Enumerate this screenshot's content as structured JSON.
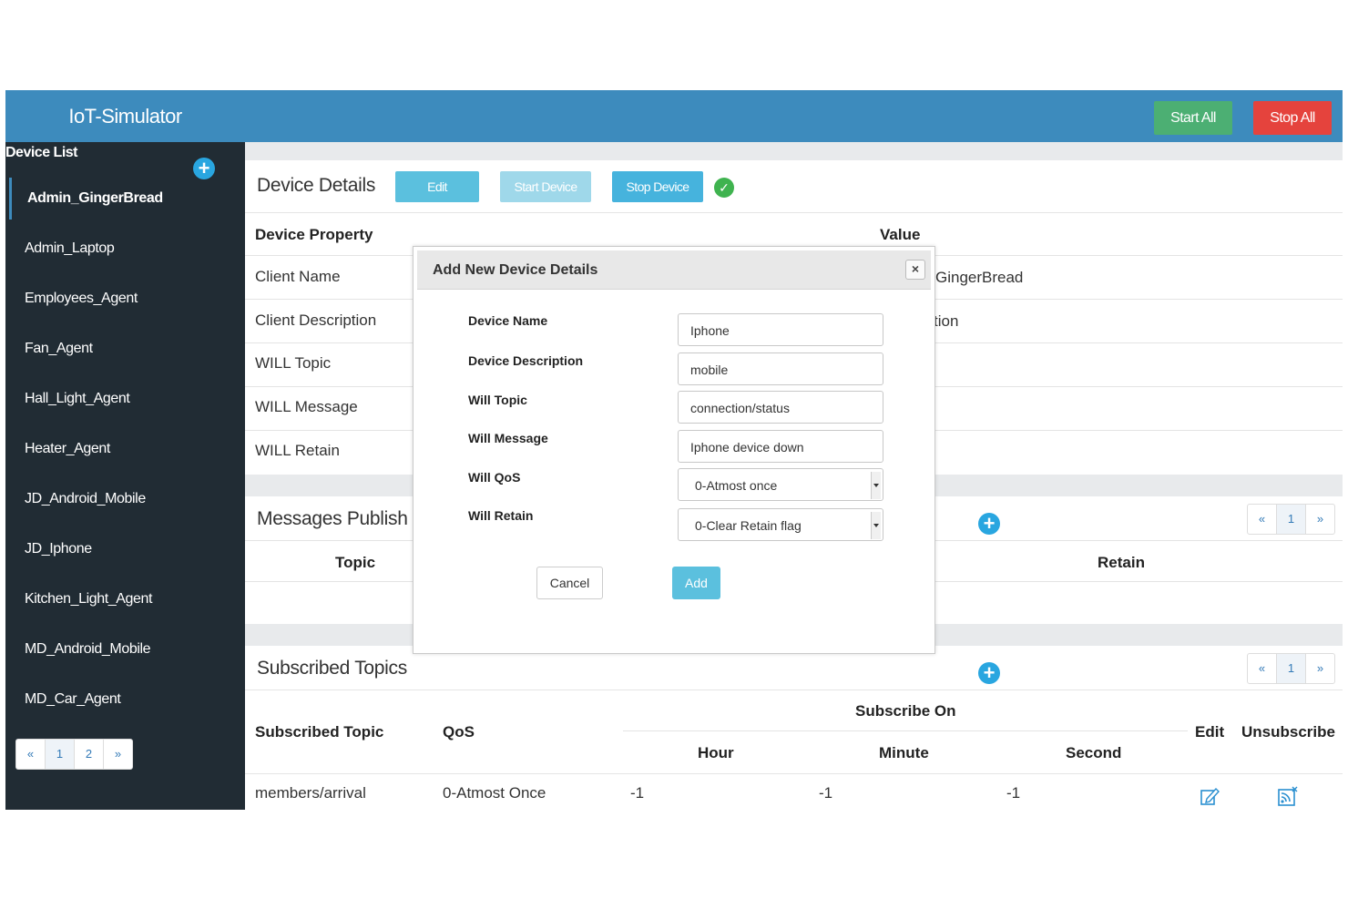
{
  "app": {
    "title": "IoT-Simulator"
  },
  "header": {
    "start_all": "Start All",
    "stop_all": "Stop All"
  },
  "sidebar": {
    "label": "Device List",
    "items": [
      "Admin_GingerBread",
      "Admin_Laptop",
      "Employees_Agent",
      "Fan_Agent",
      "Hall_Light_Agent",
      "Heater_Agent",
      "JD_Android_Mobile",
      "JD_Iphone",
      "Kitchen_Light_Agent",
      "MD_Android_Mobile",
      "MD_Car_Agent"
    ],
    "pager": [
      "«",
      "1",
      "2",
      "»"
    ]
  },
  "device_details": {
    "title": "Device Details",
    "edit": "Edit",
    "start_device": "Start Device",
    "stop_device": "Stop Device",
    "col_property": "Device Property",
    "col_value": "Value",
    "rows": [
      {
        "property": "Client Name",
        "value": "GingerBread"
      },
      {
        "property": "Client Description",
        "value": "tion"
      },
      {
        "property": "WILL Topic",
        "value": ""
      },
      {
        "property": "WILL Message",
        "value": ""
      },
      {
        "property": "WILL Retain",
        "value": ""
      }
    ]
  },
  "messages": {
    "title": "Messages Publish",
    "col_topic": "Topic",
    "col_retain": "Retain",
    "pager": [
      "«",
      "1",
      "»"
    ]
  },
  "subscribed": {
    "title": "Subscribed Topics",
    "col_topic": "Subscribed Topic",
    "col_qos": "QoS",
    "col_subscribe_on": "Subscribe On",
    "col_hour": "Hour",
    "col_minute": "Minute",
    "col_second": "Second",
    "col_edit": "Edit",
    "col_unsubscribe": "Unsubscribe",
    "pager": [
      "«",
      "1",
      "»"
    ],
    "rows": [
      {
        "topic": "members/arrival",
        "qos": "0-Atmost Once",
        "hour": "-1",
        "minute": "-1",
        "second": "-1"
      }
    ]
  },
  "modal": {
    "title": "Add New Device Details",
    "fields": [
      {
        "label": "Device Name",
        "value": "Iphone"
      },
      {
        "label": "Device Description",
        "value": "mobile"
      },
      {
        "label": "Will Topic",
        "value": "connection/status"
      },
      {
        "label": "Will Message",
        "value": "Iphone device down"
      },
      {
        "label": "Will QoS",
        "value": "0-Atmost once"
      },
      {
        "label": "Will Retain",
        "value": "0-Clear Retain flag"
      }
    ],
    "cancel": "Cancel",
    "add": "Add"
  },
  "colors": {
    "brand": "#3d8bbd",
    "sidebar": "#212c34",
    "start": "#4caf73",
    "stop": "#e5433d",
    "info": "#5bc0de"
  }
}
